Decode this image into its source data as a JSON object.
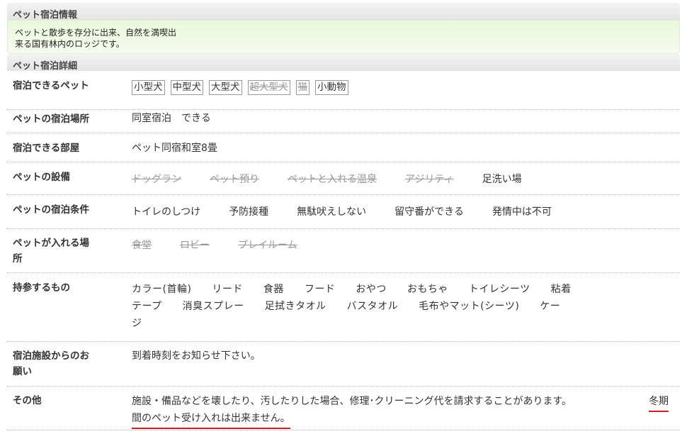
{
  "info": {
    "header": "ペット宿泊情報",
    "intro_line1": "ペットと散歩を存分に出来、自然を満喫出",
    "intro_line2": "来る国有林内のロッジです。"
  },
  "detail": {
    "header": "ペット宿泊詳細",
    "pets": {
      "label": "宿泊できるペット",
      "tags": [
        {
          "text": "小型犬",
          "available": true
        },
        {
          "text": "中型犬",
          "available": true
        },
        {
          "text": "大型犬",
          "available": true
        },
        {
          "text": "超大型犬",
          "available": false
        },
        {
          "text": "猫",
          "available": false
        },
        {
          "text": "小動物",
          "available": true
        }
      ]
    },
    "place": {
      "label": "ペットの宿泊場所",
      "value": "同室宿泊　できる"
    },
    "room": {
      "label": "宿泊できる部屋",
      "value": "ペット同宿和室8畳"
    },
    "facilities": {
      "label": "ペットの設備",
      "items": [
        {
          "text": "ドッグラン",
          "available": false
        },
        {
          "text": "ペット預り",
          "available": false
        },
        {
          "text": "ペットと入れる温泉",
          "available": false
        },
        {
          "text": "アジリティ",
          "available": false
        },
        {
          "text": "足洗い場",
          "available": true
        }
      ]
    },
    "conditions": {
      "label": "ペットの宿泊条件",
      "items": [
        "トイレのしつけ",
        "予防接種",
        "無駄吠えしない",
        "留守番ができる",
        "発情中は不可"
      ]
    },
    "access": {
      "label_line1": "ペットが入れる場",
      "label_line2": "所",
      "items": [
        {
          "text": "食堂",
          "available": false
        },
        {
          "text": "ロビー",
          "available": false
        },
        {
          "text": "プレイルーム",
          "available": false
        }
      ]
    },
    "bring": {
      "label": "持参するもの",
      "line1": "カラー(首輪)　　リード　　食器　　フード　　おやつ　　おもちゃ　　トイレシーツ　　粘着",
      "line2": "テープ　　消臭スプレー　　足拭きタオル　　バスタオル　　毛布やマット(シーツ)　　ケー",
      "line3": "ジ"
    },
    "request": {
      "label_line1": "宿泊施設からのお",
      "label_line2": "願い",
      "value": "到着時刻をお知らせ下さい。"
    },
    "other": {
      "label": "その他",
      "text1": "施設・備品などを壊したり、汚したりした場合、修理･クリーニング代を請求することがあります。",
      "red1": "冬期",
      "red2": "間のペット受け入れは出来ません。"
    },
    "red_underline_color": "#c8202a"
  }
}
